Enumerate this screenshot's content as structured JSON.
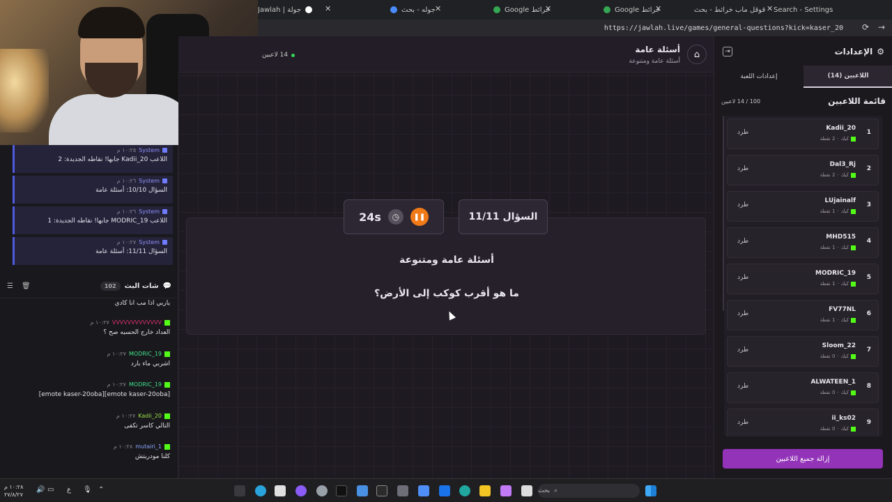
{
  "browser": {
    "tabs": [
      {
        "label": "جولة | Jawlah",
        "color": "#ffffff"
      },
      {
        "label": "جوله - بحث",
        "color": "#4a8cff"
      },
      {
        "label": "خرائط Google",
        "color": "#34a853"
      },
      {
        "label": "خرائط Google",
        "color": "#34a853"
      },
      {
        "label": "قوقل ماب خرائط - بحث",
        "color": "#4a8cff"
      },
      {
        "label": "Search - Settings",
        "color": "#cccccc"
      }
    ],
    "url": "https://jawlah.live/games/general-questions?kick=kaser_20"
  },
  "chat": {
    "system_messages": [
      {
        "author": "System",
        "time": "١٠:٢٥ م",
        "text": "اللاعب Kadii_20 جابها! نقاطه الجديدة: 2"
      },
      {
        "author": "System",
        "time": "١٠:٢٦ م",
        "text": "السؤال 10/10: أسئلة عامة"
      },
      {
        "author": "System",
        "time": "١٠:٢٦ م",
        "text": "اللاعب MODRIC_19 جابها! نقاطه الجديدة: 1"
      },
      {
        "author": "System",
        "time": "١٠:٢٧ م",
        "text": "السؤال 11/11: أسئلة عامة"
      }
    ],
    "header": {
      "title": "شات البث",
      "count": "102"
    },
    "messages": [
      {
        "author": "",
        "time": "",
        "text": "ياربي اذا مب انا كادي",
        "color": "#e4e2ea"
      },
      {
        "author": "VVVVVVVVVVVVV",
        "time": "١٠:٢٧ م",
        "text": "العداد خارج الحسبه صح ؟",
        "color": "#d6336c"
      },
      {
        "author": "MODRIC_19",
        "time": "١٠:٢٧ م",
        "text": "اشربي ماء بارد",
        "color": "#3fe08a"
      },
      {
        "author": "MODRIC_19",
        "time": "١٠:٢٧ م",
        "text": "[emote kaser-20oba][emote kaser-20oba]",
        "color": "#3fe08a"
      },
      {
        "author": "Kadii_20",
        "time": "١٠:٢٧ م",
        "text": "التالي كاسر تكفى",
        "color": "#9be34a"
      },
      {
        "author": "mutairi_1",
        "time": "١٠:٢٨ م",
        "text": "كلنا مودريتش",
        "color": "#8aa8ff"
      }
    ]
  },
  "header": {
    "title": "أسئلة عامة",
    "subtitle": "أسئلة عامة ومتنوعة",
    "players_online": "14 لاعبين"
  },
  "question": {
    "number": "السؤال 11/11",
    "timer": "24s",
    "category": "أسئلة عامة ومتنوعة",
    "text": "ما هو أقرب كوكب إلى الأرض؟"
  },
  "sidebar": {
    "title": "الإعدادات",
    "tabs": [
      "اللاعبين (14)",
      "إعدادات اللعبة"
    ],
    "list_title": "قائمة اللاعبين",
    "list_count": "100 / 14 لاعبين",
    "kick_label": "طرد",
    "platform_label": "كيك",
    "players": [
      {
        "rank": "1",
        "name": "Kadii_20",
        "points": "2 نقطة"
      },
      {
        "rank": "2",
        "name": "Dal3_Rj",
        "points": "2 نقطة"
      },
      {
        "rank": "3",
        "name": "LUjainalf",
        "points": "1 نقطة"
      },
      {
        "rank": "4",
        "name": "MHD515",
        "points": "1 نقطة"
      },
      {
        "rank": "5",
        "name": "MODRIC_19",
        "points": "1 نقطة"
      },
      {
        "rank": "6",
        "name": "FV77NL",
        "points": "1 نقطة"
      },
      {
        "rank": "7",
        "name": "Sloom_22",
        "points": "0 نقطة"
      },
      {
        "rank": "8",
        "name": "ALWATEEN_1",
        "points": "0 نقطة"
      },
      {
        "rank": "9",
        "name": "ii_ks02",
        "points": "0 نقطة"
      }
    ],
    "remove_all": "إزالة جميع اللاعبين"
  },
  "taskbar": {
    "search_placeholder": "بحث",
    "time": "١٠:٢٨ م",
    "date": "٢٧/٨/٢٧",
    "lang": "ع"
  }
}
